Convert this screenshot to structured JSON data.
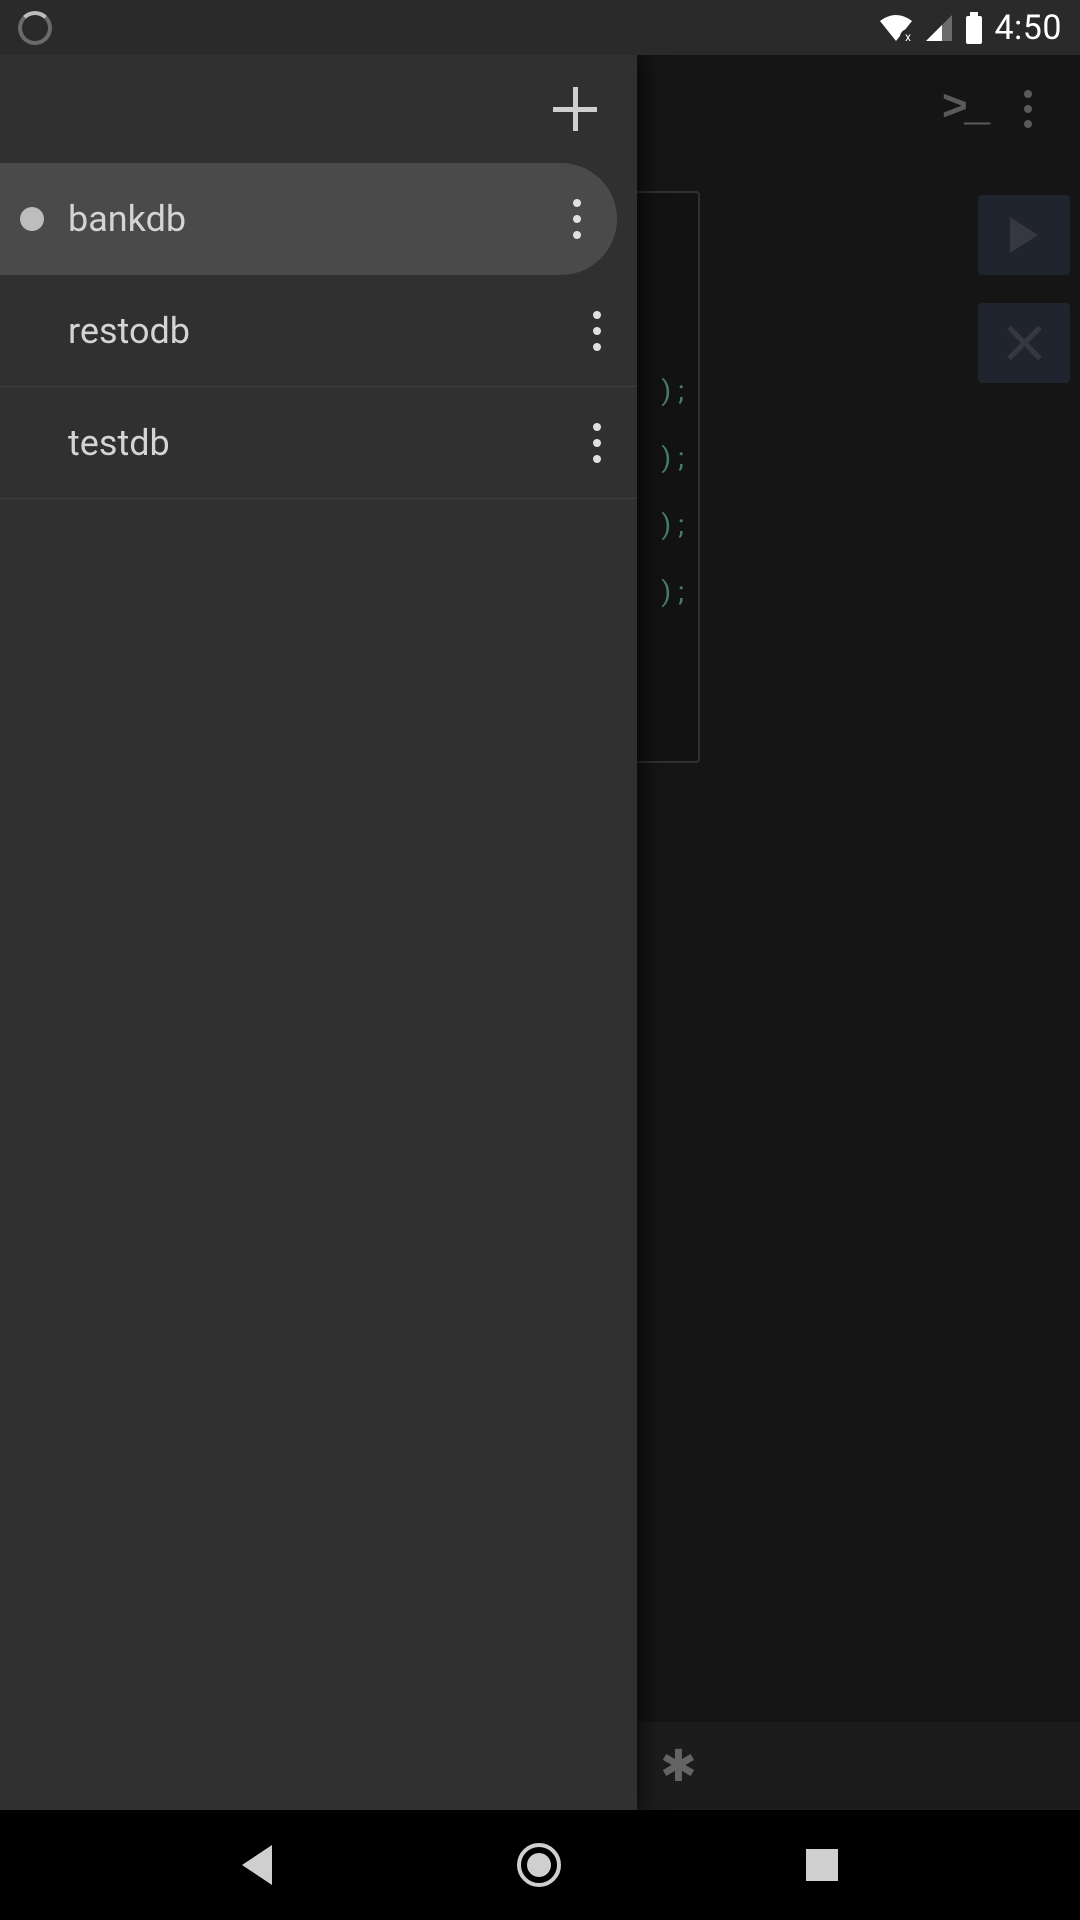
{
  "status": {
    "time": "4:50"
  },
  "drawer": {
    "items": [
      {
        "name": "bankdb",
        "selected": true
      },
      {
        "name": "restodb",
        "selected": false
      },
      {
        "name": "testdb",
        "selected": false
      }
    ]
  },
  "editor": {
    "visible_fragments": [
      ") ;",
      ") ;",
      ") ;",
      ") ;"
    ]
  },
  "bottom": {
    "asterisk": "✱"
  }
}
